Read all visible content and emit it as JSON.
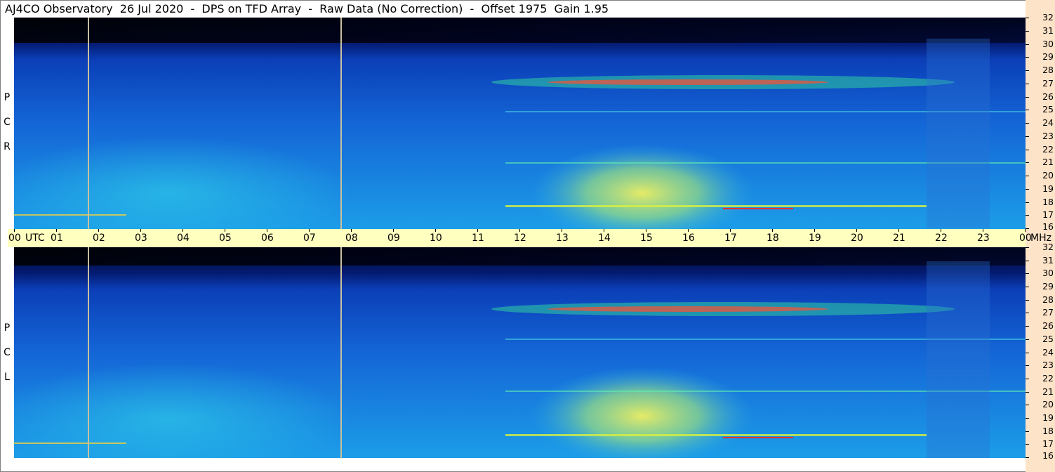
{
  "title": "AJ4CO Observatory  26 Jul 2020  -  DPS on TFD Array  -  Raw Data (No Correction)  -  Offset 1975  Gain 1.95",
  "panels": {
    "top": {
      "label": [
        "R",
        "C",
        "P"
      ]
    },
    "bottom": {
      "label": [
        "L",
        "C",
        "P"
      ]
    }
  },
  "time_axis": {
    "labels": [
      "00",
      "01",
      "02",
      "03",
      "04",
      "05",
      "06",
      "07",
      "08",
      "09",
      "10",
      "11",
      "12",
      "13",
      "14",
      "15",
      "16",
      "17",
      "18",
      "19",
      "20",
      "21",
      "22",
      "23",
      "00"
    ],
    "utc_label": "UTC",
    "mhz_label": "MHz"
  },
  "freq_axis": {
    "labels": [
      "32",
      "31",
      "30",
      "29",
      "28",
      "27",
      "26",
      "25",
      "24",
      "23",
      "22",
      "21",
      "20",
      "19",
      "18",
      "17",
      "16"
    ]
  },
  "colors": {
    "background_quiet": "#0a3aa8",
    "noise_band": "#1f8fe0",
    "burst_yellow": "#e8f060",
    "burst_red": "#ff3030",
    "marker_lines": "#c8c0a0",
    "time_bar": "#ffffc0",
    "freq_strip": "#fde3c8"
  }
}
